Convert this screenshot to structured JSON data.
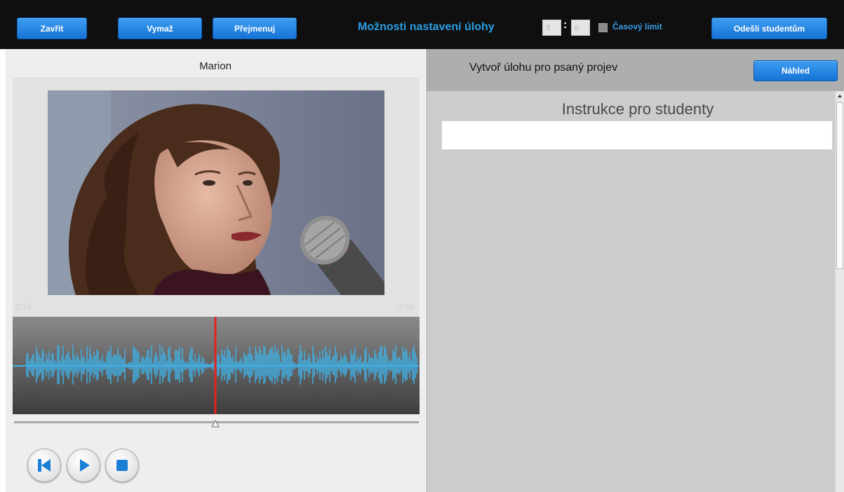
{
  "toolbar": {
    "close_label": "Zavřít",
    "clear_label": "Vymaž",
    "rename_label": "Přejmenuj",
    "title": "Možnosti nastavení úlohy",
    "time_minutes": "3",
    "time_seconds": "0",
    "time_separator": ":",
    "time_limit_label": "Časový limit",
    "time_limit_checked": false,
    "send_label": "Odešli studentům"
  },
  "media": {
    "title": "Marion",
    "time_current": "0:15",
    "time_total": "0:16",
    "waveform_color": "#3fb3ea",
    "playhead_color": "#e5211f",
    "controls": {
      "rewind_icon": "skip-to-start-icon",
      "play_icon": "play-icon",
      "stop_icon": "stop-icon"
    }
  },
  "task": {
    "title": "Vytvoř úlohu pro psaný projev",
    "preview_label": "Náhled",
    "instructions_heading": "Instrukce pro studenty",
    "instructions_value": ""
  },
  "colors": {
    "accent_button": "#1f86e6",
    "accent_text": "#2a9de2",
    "toolbar_bg": "#0f0f0f",
    "icon_blue": "#1b7fd6"
  }
}
